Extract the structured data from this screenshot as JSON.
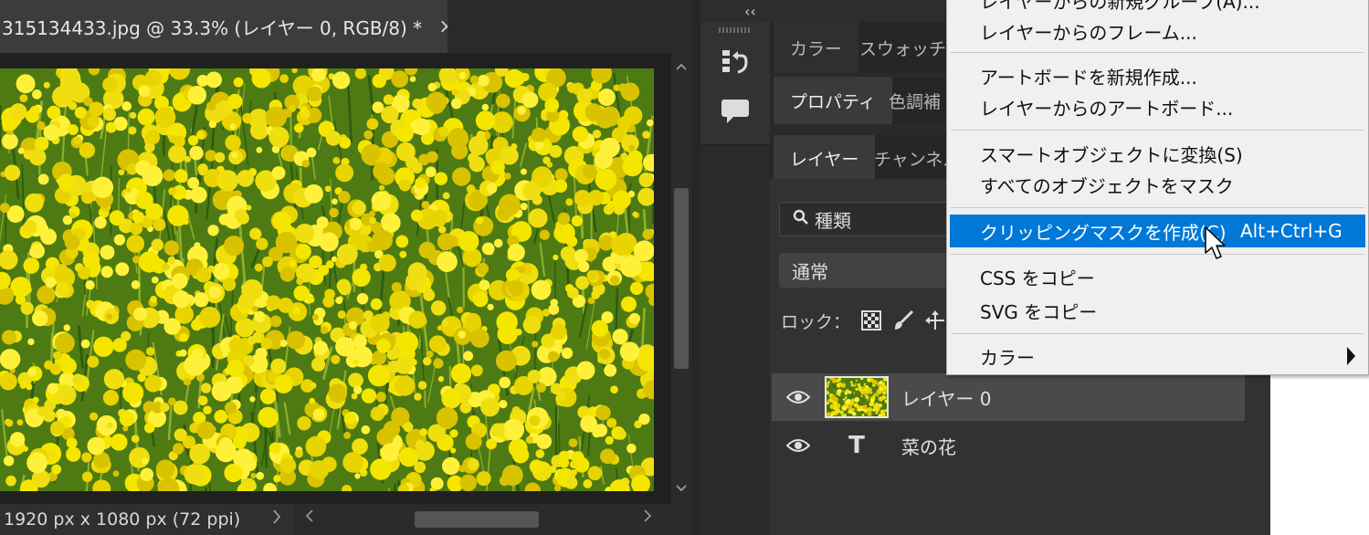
{
  "document": {
    "tab_title": "315134433.jpg @ 33.3% (レイヤー 0, RGB/8) *",
    "close_glyph": "×",
    "status_text": "1920 px x 1080 px (72 ppi)",
    "status_arrow": "〉",
    "scroll_up": "^",
    "scroll_down": "v",
    "scroll_left": "‹",
    "scroll_right": "›"
  },
  "panel_strip": {
    "collapse": "‹‹",
    "icons": [
      "history-icon",
      "comment-icon"
    ]
  },
  "panels": {
    "tabs_row1": [
      "カラー",
      "スウォッチ"
    ],
    "tabs_row2": [
      "プロパティ",
      "色調補"
    ],
    "tabs_row3": [
      "レイヤー",
      "チャンネル"
    ],
    "filter_label": "種類",
    "blend_mode": "通常",
    "lock_label": "ロック：",
    "layers": [
      {
        "name": "レイヤー 0",
        "kind": "image",
        "visible": true,
        "selected": true
      },
      {
        "name": "菜の花",
        "kind": "text",
        "type_glyph": "T",
        "visible": true,
        "selected": false
      }
    ]
  },
  "context_menu": {
    "top_partial": "レイヤーからの新規グループ(A)...",
    "items": [
      {
        "label": "レイヤーからのフレーム..."
      },
      {
        "label": "アートボードを新規作成..."
      },
      {
        "label": "レイヤーからのアートボード..."
      },
      {
        "label": "スマートオブジェクトに変換(S)"
      },
      {
        "label": "すべてのオブジェクトをマスク"
      },
      {
        "label": "クリッピングマスクを作成(C)",
        "shortcut": "Alt+Ctrl+G",
        "highlighted": true
      },
      {
        "label": "CSS をコピー"
      },
      {
        "label": "SVG をコピー"
      },
      {
        "label": "カラー",
        "submenu": true
      }
    ]
  },
  "colors": {
    "highlight": "#0078d7",
    "menu_bg": "#f0f0f0",
    "ui_dark": "#2a2a2a",
    "flower_yellow": "#f2e200"
  }
}
